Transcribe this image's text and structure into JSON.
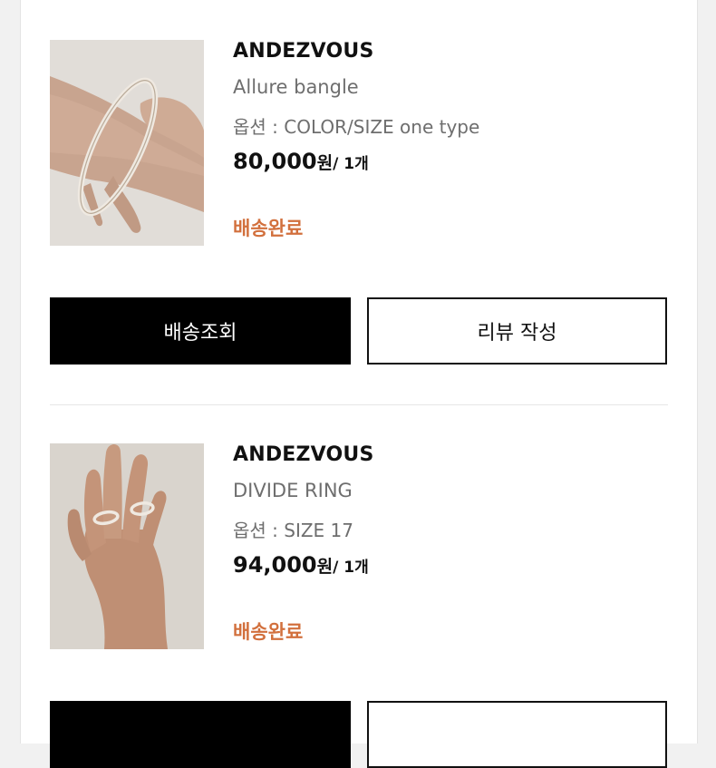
{
  "orders": [
    {
      "brand": "ANDEZVOUS",
      "product_name": "Allure bangle",
      "option": "옵션 : COLOR/SIZE one type",
      "price": "80,000",
      "currency": "원",
      "quantity": "/ 1개",
      "status": "배송완료",
      "track_button": "배송조회",
      "review_button": "리뷰 작성",
      "image": "bangle-on-wrist-photo"
    },
    {
      "brand": "ANDEZVOUS",
      "product_name": "DIVIDE RING",
      "option": "옵션 : SIZE 17",
      "price": "94,000",
      "currency": "원",
      "quantity": "/ 1개",
      "status": "배송완료",
      "track_button": "",
      "review_button": "",
      "image": "ring-on-hand-photo"
    }
  ],
  "colors": {
    "status": "#d2703d",
    "primary_button_bg": "#000000",
    "secondary_button_border": "#111111",
    "muted_text": "#6e6e6e"
  }
}
